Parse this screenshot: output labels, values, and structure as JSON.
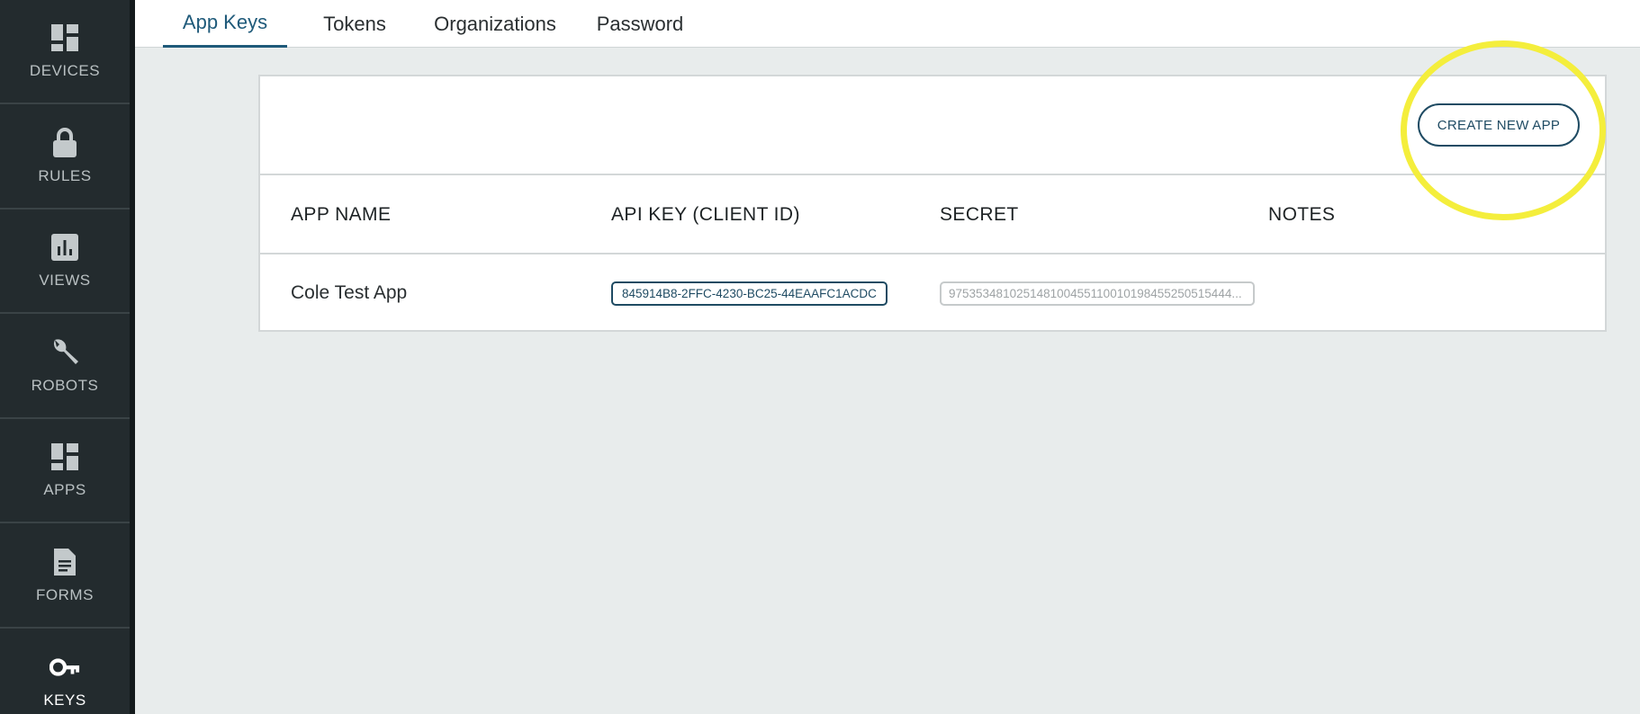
{
  "sidebar": {
    "items": [
      {
        "label": "DEVICES",
        "icon": "dashboard-icon"
      },
      {
        "label": "RULES",
        "icon": "lock-icon"
      },
      {
        "label": "VIEWS",
        "icon": "bar-chart-icon"
      },
      {
        "label": "ROBOTS",
        "icon": "wrench-icon"
      },
      {
        "label": "APPS",
        "icon": "dashboard-icon"
      },
      {
        "label": "FORMS",
        "icon": "document-icon"
      },
      {
        "label": "KEYS",
        "icon": "key-icon",
        "active": true
      }
    ]
  },
  "tabs": [
    {
      "label": "App Keys",
      "active": true
    },
    {
      "label": "Tokens"
    },
    {
      "label": "Organizations"
    },
    {
      "label": "Password"
    }
  ],
  "panel": {
    "create_button": "CREATE NEW APP",
    "columns": [
      "APP NAME",
      "API KEY (CLIENT ID)",
      "SECRET",
      "NOTES"
    ],
    "rows": [
      {
        "app_name": "Cole Test App",
        "api_key": "845914B8-2FFC-4230-BC25-44EAAFC1ACDC",
        "secret": "975353481025148100455110010198455250515444...",
        "notes": ""
      }
    ]
  },
  "colors": {
    "sidebar_bg": "#232b2e",
    "accent": "#1f5a7a",
    "highlight": "#f4ee3c",
    "page_bg": "#e8ecec"
  }
}
